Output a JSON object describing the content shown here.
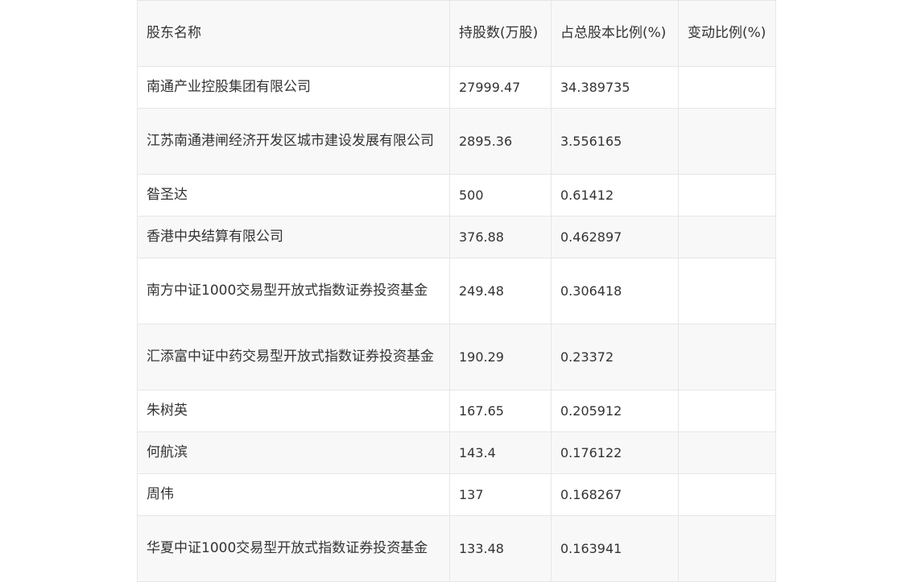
{
  "table": {
    "headers": [
      "股东名称",
      "持股数(万股)",
      "占总股本比例(%)",
      "变动比例(%)"
    ],
    "rows": [
      {
        "name": "南通产业控股集团有限公司",
        "shares": "27999.47",
        "ratio": "34.389735",
        "change": ""
      },
      {
        "name": "江苏南通港闸经济开发区城市建设发展有限公司",
        "shares": "2895.36",
        "ratio": "3.556165",
        "change": ""
      },
      {
        "name": "昝圣达",
        "shares": "500",
        "ratio": "0.61412",
        "change": ""
      },
      {
        "name": "香港中央结算有限公司",
        "shares": "376.88",
        "ratio": "0.462897",
        "change": ""
      },
      {
        "name": "南方中证1000交易型开放式指数证券投资基金",
        "shares": "249.48",
        "ratio": "0.306418",
        "change": ""
      },
      {
        "name": "汇添富中证中药交易型开放式指数证券投资基金",
        "shares": "190.29",
        "ratio": "0.23372",
        "change": ""
      },
      {
        "name": "朱树英",
        "shares": "167.65",
        "ratio": "0.205912",
        "change": ""
      },
      {
        "name": "何航滨",
        "shares": "143.4",
        "ratio": "0.176122",
        "change": ""
      },
      {
        "name": "周伟",
        "shares": "137",
        "ratio": "0.168267",
        "change": ""
      },
      {
        "name": "华夏中证1000交易型开放式指数证券投资基金",
        "shares": "133.48",
        "ratio": "0.163941",
        "change": ""
      }
    ]
  }
}
